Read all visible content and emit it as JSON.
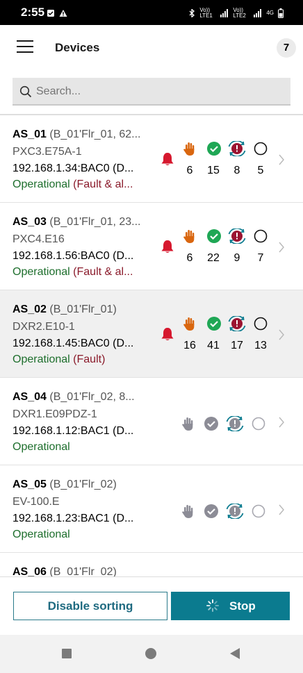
{
  "status_bar": {
    "time": "2:55",
    "network_labels": [
      "Vo)) LTE1",
      "Vo)) LTE2",
      "4G"
    ]
  },
  "header": {
    "title": "Devices",
    "count": "7"
  },
  "search": {
    "placeholder": "Search..."
  },
  "devices": [
    {
      "name": "AS_01",
      "location": "(B_01'Flr_01, 62...",
      "model": "PXC3.E75A-1",
      "address": "192.168.1.34:BAC0 (D...",
      "status": "Operational",
      "status_detail": "(Fault & al...",
      "alarm": true,
      "active": true,
      "counts": {
        "manual": "6",
        "ok": "15",
        "fault": "8",
        "idle": "5"
      }
    },
    {
      "name": "AS_03",
      "location": "(B_01'Flr_01, 23...",
      "model": "PXC4.E16",
      "address": "192.168.1.56:BAC0 (D...",
      "status": "Operational",
      "status_detail": "(Fault & al...",
      "alarm": true,
      "active": true,
      "counts": {
        "manual": "6",
        "ok": "22",
        "fault": "9",
        "idle": "7"
      }
    },
    {
      "name": "AS_02",
      "location": "(B_01'Flr_01)",
      "model": "DXR2.E10-1",
      "address": "192.168.1.45:BAC0 (D...",
      "status": "Operational",
      "status_detail": "(Fault)",
      "alarm": true,
      "active": true,
      "selected": true,
      "counts": {
        "manual": "16",
        "ok": "41",
        "fault": "17",
        "idle": "13"
      }
    },
    {
      "name": "AS_04",
      "location": "(B_01'Flr_02, 8...",
      "model": "DXR1.E09PDZ-1",
      "address": "192.168.1.12:BAC1 (D...",
      "status": "Operational",
      "status_detail": "",
      "alarm": false,
      "active": false,
      "counts": {
        "manual": "",
        "ok": "",
        "fault": "",
        "idle": ""
      }
    },
    {
      "name": "AS_05",
      "location": "(B_01'Flr_02)",
      "model": "EV-100.E",
      "address": "192.168.1.23:BAC1 (D...",
      "status": "Operational",
      "status_detail": "",
      "alarm": false,
      "active": false,
      "counts": {
        "manual": "",
        "ok": "",
        "fault": "",
        "idle": ""
      }
    },
    {
      "name": "AS_06",
      "location": "(B_01'Flr_02)",
      "model": "",
      "address": "",
      "status": "",
      "status_detail": "",
      "alarm": false,
      "active": false,
      "partial": true,
      "counts": {
        "manual": "",
        "ok": "",
        "fault": "",
        "idle": ""
      }
    }
  ],
  "footer": {
    "disable_sorting_label": "Disable sorting",
    "stop_label": "Stop"
  },
  "colors": {
    "accent": "#0b7b8f",
    "operational": "#1d6e2c",
    "fault_text": "#8a1a2a",
    "alarm_red": "#d6182e",
    "manual_orange": "#d9660f",
    "ok_green": "#1fa755",
    "fault_badge": "#9b1431",
    "inactive_gray": "#8c8c96"
  }
}
